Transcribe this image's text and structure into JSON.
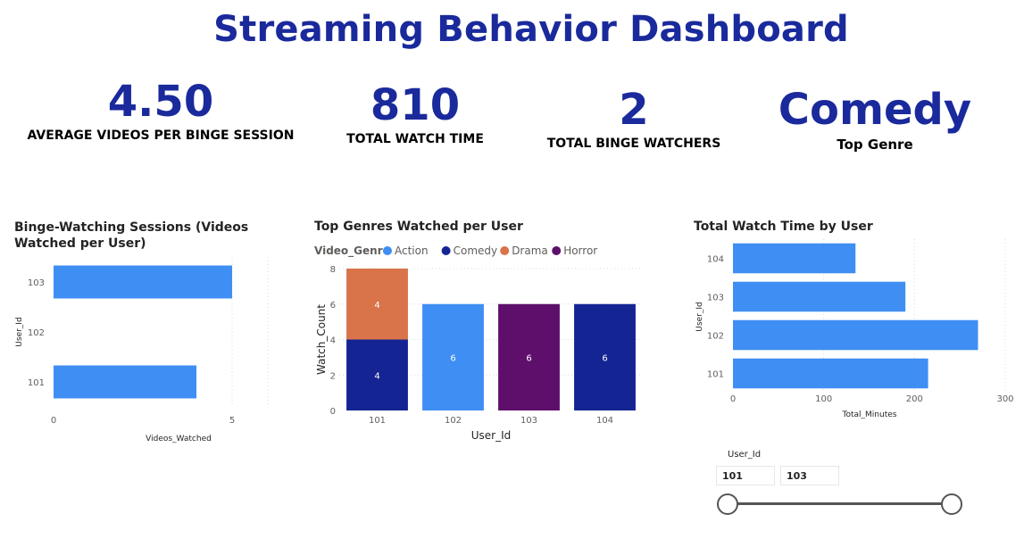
{
  "title": "Streaming Behavior Dashboard",
  "kpis": [
    {
      "value": "4.50",
      "label": "AVERAGE VIDEOS PER BINGE SESSION"
    },
    {
      "value": "810",
      "label": "TOTAL WATCH TIME"
    },
    {
      "value": "2",
      "label": "TOTAL BINGE WATCHERS"
    },
    {
      "value": "Comedy",
      "label": "Top Genre"
    }
  ],
  "colors": {
    "accent": "#1a2a9c",
    "action": "#3f8ef3",
    "comedy": "#152493",
    "drama": "#d8734a",
    "horror": "#5e0f6b"
  },
  "chart_data": [
    {
      "type": "bar",
      "orientation": "horizontal",
      "title": "Binge-Watching Sessions (Videos Watched per User)",
      "categories": [
        "103",
        "102",
        "101"
      ],
      "values": [
        5,
        null,
        4
      ],
      "xlabel": "Videos_Watched",
      "ylabel": "User_Id",
      "xlim": [
        0,
        6
      ],
      "xticks": [
        "0",
        "5"
      ],
      "grid": true
    },
    {
      "type": "bar",
      "orientation": "vertical",
      "stacked": true,
      "title": "Top Genres Watched per User",
      "legend_title": "Video_Genre",
      "legend_position": "top-left",
      "categories": [
        "101",
        "102",
        "103",
        "104"
      ],
      "series": [
        {
          "name": "Action",
          "values": [
            0,
            6,
            0,
            0
          ]
        },
        {
          "name": "Comedy",
          "values": [
            4,
            0,
            0,
            6
          ]
        },
        {
          "name": "Drama",
          "values": [
            4,
            0,
            0,
            0
          ]
        },
        {
          "name": "Horror",
          "values": [
            0,
            0,
            6,
            0
          ]
        }
      ],
      "xlabel": "User_Id",
      "ylabel": "Watch_Count",
      "ylim": [
        0,
        8
      ],
      "yticks": [
        "0",
        "2",
        "4",
        "6",
        "8"
      ],
      "grid": true
    },
    {
      "type": "bar",
      "orientation": "horizontal",
      "title": "Total Watch Time by User",
      "categories": [
        "104",
        "103",
        "102",
        "101"
      ],
      "values": [
        135,
        190,
        270,
        215
      ],
      "xlabel": "Total_Minutes",
      "ylabel": "User_Id",
      "xlim": [
        0,
        300
      ],
      "xticks": [
        "0",
        "100",
        "200",
        "300"
      ],
      "grid": true
    }
  ],
  "slicer": {
    "label": "User_Id",
    "min_value": "101",
    "max_value": "103"
  }
}
